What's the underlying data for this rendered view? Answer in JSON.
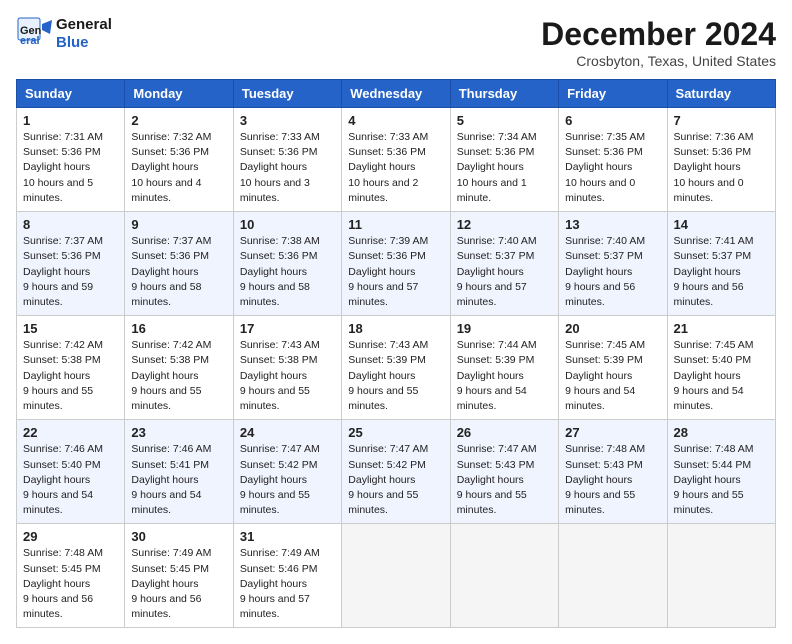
{
  "logo": {
    "general": "General",
    "blue": "Blue",
    "tagline": "GeneralBlue"
  },
  "title": "December 2024",
  "location": "Crosbyton, Texas, United States",
  "days_of_week": [
    "Sunday",
    "Monday",
    "Tuesday",
    "Wednesday",
    "Thursday",
    "Friday",
    "Saturday"
  ],
  "weeks": [
    [
      {
        "day": 1,
        "sunrise": "7:31 AM",
        "sunset": "5:36 PM",
        "daylight": "10 hours and 5 minutes."
      },
      {
        "day": 2,
        "sunrise": "7:32 AM",
        "sunset": "5:36 PM",
        "daylight": "10 hours and 4 minutes."
      },
      {
        "day": 3,
        "sunrise": "7:33 AM",
        "sunset": "5:36 PM",
        "daylight": "10 hours and 3 minutes."
      },
      {
        "day": 4,
        "sunrise": "7:33 AM",
        "sunset": "5:36 PM",
        "daylight": "10 hours and 2 minutes."
      },
      {
        "day": 5,
        "sunrise": "7:34 AM",
        "sunset": "5:36 PM",
        "daylight": "10 hours and 1 minute."
      },
      {
        "day": 6,
        "sunrise": "7:35 AM",
        "sunset": "5:36 PM",
        "daylight": "10 hours and 0 minutes."
      },
      {
        "day": 7,
        "sunrise": "7:36 AM",
        "sunset": "5:36 PM",
        "daylight": "10 hours and 0 minutes."
      }
    ],
    [
      {
        "day": 8,
        "sunrise": "7:37 AM",
        "sunset": "5:36 PM",
        "daylight": "9 hours and 59 minutes."
      },
      {
        "day": 9,
        "sunrise": "7:37 AM",
        "sunset": "5:36 PM",
        "daylight": "9 hours and 58 minutes."
      },
      {
        "day": 10,
        "sunrise": "7:38 AM",
        "sunset": "5:36 PM",
        "daylight": "9 hours and 58 minutes."
      },
      {
        "day": 11,
        "sunrise": "7:39 AM",
        "sunset": "5:36 PM",
        "daylight": "9 hours and 57 minutes."
      },
      {
        "day": 12,
        "sunrise": "7:40 AM",
        "sunset": "5:37 PM",
        "daylight": "9 hours and 57 minutes."
      },
      {
        "day": 13,
        "sunrise": "7:40 AM",
        "sunset": "5:37 PM",
        "daylight": "9 hours and 56 minutes."
      },
      {
        "day": 14,
        "sunrise": "7:41 AM",
        "sunset": "5:37 PM",
        "daylight": "9 hours and 56 minutes."
      }
    ],
    [
      {
        "day": 15,
        "sunrise": "7:42 AM",
        "sunset": "5:38 PM",
        "daylight": "9 hours and 55 minutes."
      },
      {
        "day": 16,
        "sunrise": "7:42 AM",
        "sunset": "5:38 PM",
        "daylight": "9 hours and 55 minutes."
      },
      {
        "day": 17,
        "sunrise": "7:43 AM",
        "sunset": "5:38 PM",
        "daylight": "9 hours and 55 minutes."
      },
      {
        "day": 18,
        "sunrise": "7:43 AM",
        "sunset": "5:39 PM",
        "daylight": "9 hours and 55 minutes."
      },
      {
        "day": 19,
        "sunrise": "7:44 AM",
        "sunset": "5:39 PM",
        "daylight": "9 hours and 54 minutes."
      },
      {
        "day": 20,
        "sunrise": "7:45 AM",
        "sunset": "5:39 PM",
        "daylight": "9 hours and 54 minutes."
      },
      {
        "day": 21,
        "sunrise": "7:45 AM",
        "sunset": "5:40 PM",
        "daylight": "9 hours and 54 minutes."
      }
    ],
    [
      {
        "day": 22,
        "sunrise": "7:46 AM",
        "sunset": "5:40 PM",
        "daylight": "9 hours and 54 minutes."
      },
      {
        "day": 23,
        "sunrise": "7:46 AM",
        "sunset": "5:41 PM",
        "daylight": "9 hours and 54 minutes."
      },
      {
        "day": 24,
        "sunrise": "7:47 AM",
        "sunset": "5:42 PM",
        "daylight": "9 hours and 55 minutes."
      },
      {
        "day": 25,
        "sunrise": "7:47 AM",
        "sunset": "5:42 PM",
        "daylight": "9 hours and 55 minutes."
      },
      {
        "day": 26,
        "sunrise": "7:47 AM",
        "sunset": "5:43 PM",
        "daylight": "9 hours and 55 minutes."
      },
      {
        "day": 27,
        "sunrise": "7:48 AM",
        "sunset": "5:43 PM",
        "daylight": "9 hours and 55 minutes."
      },
      {
        "day": 28,
        "sunrise": "7:48 AM",
        "sunset": "5:44 PM",
        "daylight": "9 hours and 55 minutes."
      }
    ],
    [
      {
        "day": 29,
        "sunrise": "7:48 AM",
        "sunset": "5:45 PM",
        "daylight": "9 hours and 56 minutes."
      },
      {
        "day": 30,
        "sunrise": "7:49 AM",
        "sunset": "5:45 PM",
        "daylight": "9 hours and 56 minutes."
      },
      {
        "day": 31,
        "sunrise": "7:49 AM",
        "sunset": "5:46 PM",
        "daylight": "9 hours and 57 minutes."
      },
      null,
      null,
      null,
      null
    ]
  ]
}
